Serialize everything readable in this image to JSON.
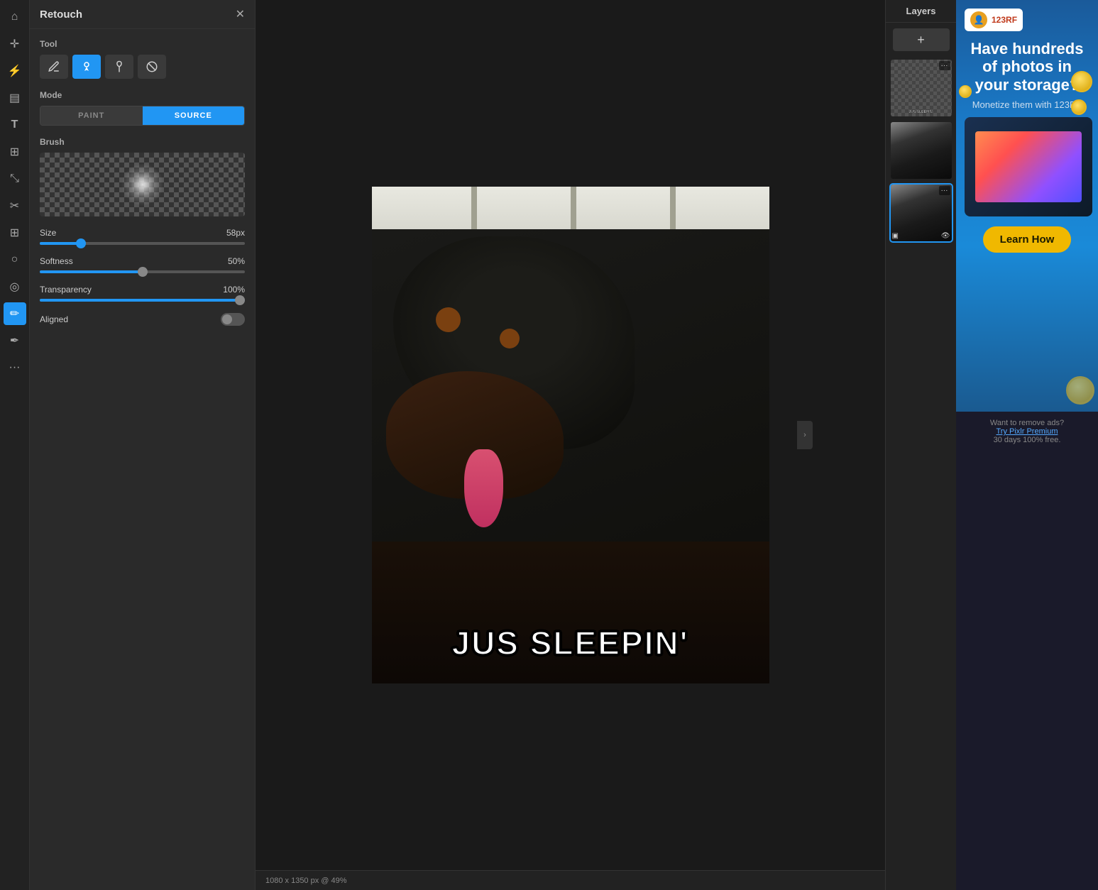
{
  "app": {
    "title": "Retouch",
    "close_label": "✕"
  },
  "left_toolbar": {
    "icons": [
      {
        "name": "home-icon",
        "glyph": "⌂"
      },
      {
        "name": "move-icon",
        "glyph": "↔"
      },
      {
        "name": "lightning-icon",
        "glyph": "⚡"
      },
      {
        "name": "layers-icon",
        "glyph": "▤"
      },
      {
        "name": "text-icon",
        "glyph": "T"
      },
      {
        "name": "grid-icon",
        "glyph": "⊞"
      },
      {
        "name": "crop-icon",
        "glyph": "⤡"
      },
      {
        "name": "scissors-icon",
        "glyph": "✂"
      },
      {
        "name": "adjust-icon",
        "glyph": "⊞"
      },
      {
        "name": "circle-icon",
        "glyph": "○"
      },
      {
        "name": "spiral-icon",
        "glyph": "◎"
      },
      {
        "name": "brush-icon",
        "glyph": "✏"
      },
      {
        "name": "pen-icon",
        "glyph": "✒"
      },
      {
        "name": "dots-icon",
        "glyph": "…"
      }
    ]
  },
  "retouch_panel": {
    "title": "Retouch",
    "sections": {
      "tool": {
        "label": "Tool",
        "buttons": [
          {
            "name": "pencil-tool",
            "glyph": "✏",
            "active": false
          },
          {
            "name": "stamp-tool",
            "glyph": "🕐",
            "active": true
          },
          {
            "name": "drop-tool",
            "glyph": "💧",
            "active": false
          },
          {
            "name": "erase-tool",
            "glyph": "⊘",
            "active": false
          }
        ]
      },
      "mode": {
        "label": "Mode",
        "buttons": [
          {
            "name": "paint-mode",
            "label": "PAINT",
            "active": false
          },
          {
            "name": "source-mode",
            "label": "SOURCE",
            "active": true
          }
        ]
      },
      "brush": {
        "label": "Brush"
      },
      "size": {
        "label": "Size",
        "value": "58px",
        "percent": 20
      },
      "softness": {
        "label": "Softness",
        "value": "50%",
        "percent": 50
      },
      "transparency": {
        "label": "Transparency",
        "value": "100%",
        "percent": 100
      },
      "aligned": {
        "label": "Aligned"
      }
    }
  },
  "canvas": {
    "meme_text": "JUS SLEEPIN'",
    "status": "1080 x 1350 px @ 49%"
  },
  "layers": {
    "title": "Layers",
    "add_label": "+"
  },
  "ad": {
    "logo_text": "123RF",
    "headline": "Have hundreds of photos in your storage?",
    "sub_text": "Monetize them with 123RF",
    "cta_label": "Learn How",
    "remove_ads_text": "Want to remove ads?",
    "premium_link": "Try Pixlr Premium",
    "trial_text": "30 days 100% free."
  }
}
